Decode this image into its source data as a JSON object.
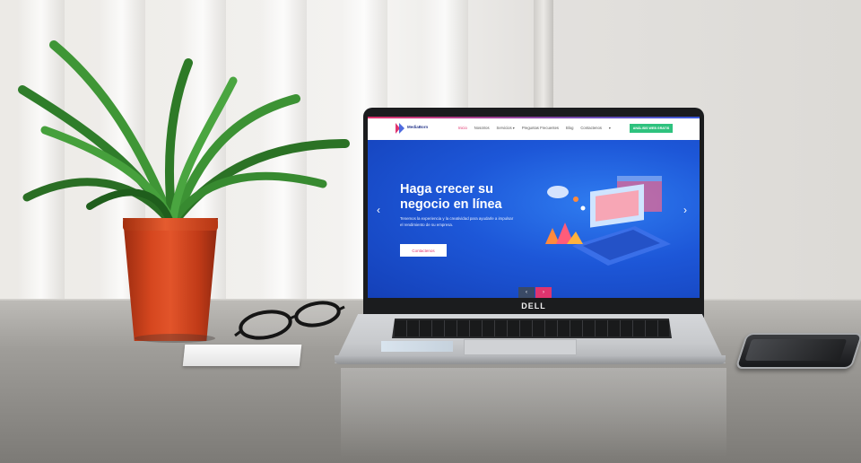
{
  "laptop": {
    "brand": "DELL"
  },
  "website": {
    "logo_text": "MediaBorn",
    "nav": [
      {
        "label": "Inicio",
        "active": true
      },
      {
        "label": "Nosotros",
        "active": false
      },
      {
        "label": "Servicios ▾",
        "active": false
      },
      {
        "label": "Preguntas Frecuentes",
        "active": false
      },
      {
        "label": "Blog",
        "active": false
      },
      {
        "label": "Contactenos",
        "active": false
      },
      {
        "label": "▾",
        "active": false
      }
    ],
    "cta_label": "ANÁLISIS WEB GRATIS",
    "hero": {
      "title": "Haga crecer su negocio en línea",
      "subtitle": "Tenemos la experiencia y la creatividad para ayudarle a impulsar el rendimiento de su empresa.",
      "button_label": "Contactenos"
    },
    "arrows": {
      "left": "‹",
      "right": "›",
      "prev": "‹",
      "next": "›"
    }
  },
  "colors": {
    "accent": "#e0346e",
    "hero_blue": "#1d57d8",
    "cta_green": "#2ec27e",
    "pot_orange": "#d6471f"
  },
  "icons": [
    "chevron-left-icon",
    "chevron-right-icon",
    "logo-mark-icon"
  ]
}
